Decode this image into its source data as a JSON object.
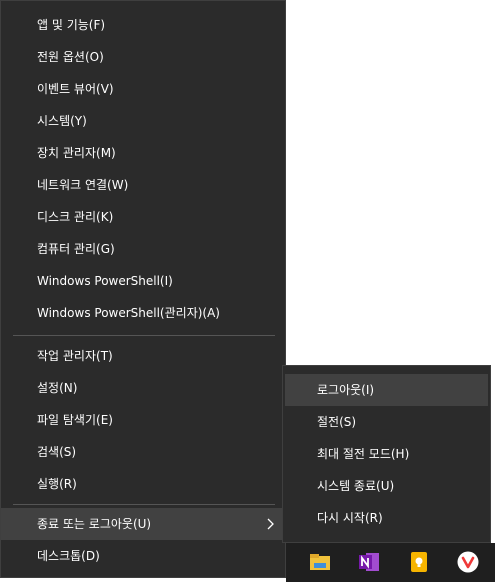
{
  "menu": {
    "items": [
      {
        "label": "앱 및 기능(F)"
      },
      {
        "label": "전원 옵션(O)"
      },
      {
        "label": "이벤트 뷰어(V)"
      },
      {
        "label": "시스템(Y)"
      },
      {
        "label": "장치 관리자(M)"
      },
      {
        "label": "네트워크 연결(W)"
      },
      {
        "label": "디스크 관리(K)"
      },
      {
        "label": "컴퓨터 관리(G)"
      },
      {
        "label": "Windows PowerShell(I)"
      },
      {
        "label": "Windows PowerShell(관리자)(A)"
      },
      {
        "label": "작업 관리자(T)"
      },
      {
        "label": "설정(N)"
      },
      {
        "label": "파일 탐색기(E)"
      },
      {
        "label": "검색(S)"
      },
      {
        "label": "실행(R)"
      },
      {
        "label": "종료 또는 로그아웃(U)"
      },
      {
        "label": "데스크톱(D)"
      }
    ],
    "submenu_arrow": "chevron-right-icon"
  },
  "submenu": {
    "items": [
      {
        "label": "로그아웃(I)"
      },
      {
        "label": "절전(S)"
      },
      {
        "label": "최대 절전 모드(H)"
      },
      {
        "label": "시스템 종료(U)"
      },
      {
        "label": "다시 시작(R)"
      }
    ]
  },
  "taskbar": {
    "icons": [
      "file-explorer-icon",
      "onenote-icon",
      "keep-icon",
      "vivaldi-icon"
    ]
  },
  "colors": {
    "menu_bg": "#2b2b2b",
    "hover_bg": "#414141",
    "separator": "#555555",
    "text": "#ffffff",
    "taskbar_bg": "#1f1f1f"
  }
}
